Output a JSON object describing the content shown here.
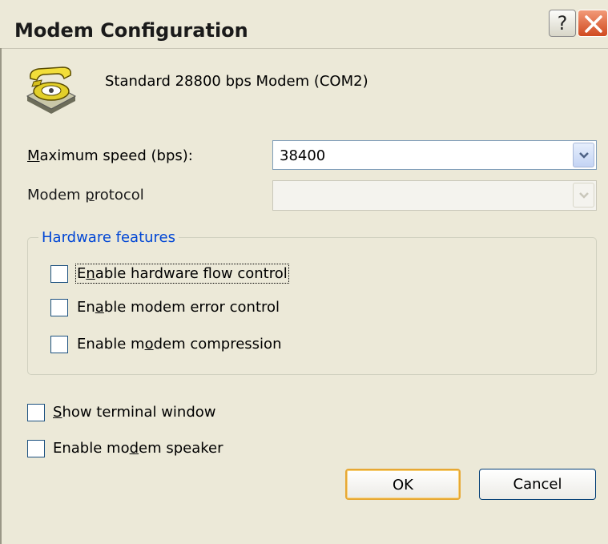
{
  "window": {
    "title": "Modem Configuration",
    "help_label": "?"
  },
  "device": {
    "name": "Standard 28800 bps Modem (COM2)",
    "icon": "telephone-modem-icon"
  },
  "max_speed": {
    "label": "Maximum speed (bps):",
    "value": "38400"
  },
  "modem_protocol": {
    "label": "Modem protocol",
    "value": "",
    "enabled": false
  },
  "hardware_features": {
    "title": "Hardware features",
    "options": [
      {
        "label": "Enable hardware flow control",
        "checked": false
      },
      {
        "label": "Enable modem error control",
        "checked": false
      },
      {
        "label": "Enable modem compression",
        "checked": false
      }
    ]
  },
  "options": [
    {
      "label": "Show terminal window",
      "checked": false
    },
    {
      "label": "Enable modem speaker",
      "checked": false
    }
  ],
  "buttons": {
    "ok": "OK",
    "cancel": "Cancel"
  },
  "colors": {
    "face": "#ece9d8",
    "group_title": "#0046d5",
    "default_button_border": "#e7a834",
    "close_button": "#d04a20"
  }
}
